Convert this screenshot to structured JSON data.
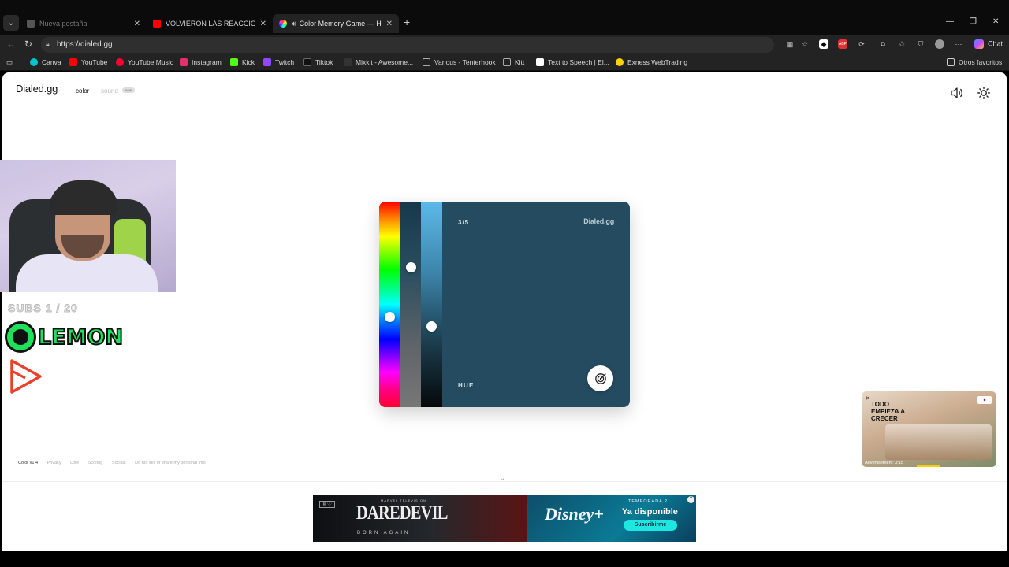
{
  "browser": {
    "tabs": [
      {
        "title": "Nueva pestaña",
        "state": "inactive",
        "favicon_color": "#555555"
      },
      {
        "title": "VOLVIERON LAS REACCIONES • D",
        "state": "inactive",
        "favicon_color": "#ff0000"
      },
      {
        "title": "Color Memory Game — How",
        "state": "active",
        "favicon_color": "#9b59b6"
      }
    ],
    "url": "https://dialed.gg",
    "chat_label": "Chat",
    "bookmarks": [
      {
        "label": "Canva",
        "color": "#00c4cc"
      },
      {
        "label": "YouTube",
        "color": "#ff0000"
      },
      {
        "label": "YouTube Music",
        "color": "#ff0033"
      },
      {
        "label": "Instagram",
        "color": "#e1306c"
      },
      {
        "label": "Kick",
        "color": "#53fc18"
      },
      {
        "label": "Twitch",
        "color": "#9146ff"
      },
      {
        "label": "Tiktok",
        "color": "#111111"
      },
      {
        "label": "Mixkit - Awesome...",
        "color": "#333333"
      },
      {
        "label": "Various - Tenterhook",
        "color": "#222222"
      },
      {
        "label": "Kitt",
        "color": "#222222"
      },
      {
        "label": "Text to Speech | El...",
        "color": "#ffffff"
      },
      {
        "label": "Exness WebTrading",
        "color": "#ffd200"
      }
    ],
    "other_favorites": "Otros favoritos"
  },
  "site": {
    "logo": "Dialed.gg",
    "nav": {
      "color": "color",
      "sound": "sound",
      "new_badge": "new"
    },
    "icons": {
      "volume": "volume-icon",
      "theme": "sun-icon"
    }
  },
  "game": {
    "progress": "3/5",
    "brand": "Dialed.gg",
    "mode_label": "HUE",
    "target_color": "#254b60",
    "sliders": {
      "hue": 0.56,
      "saturation": 0.32,
      "brightness": 0.61
    },
    "submit_icon": "target-icon"
  },
  "footer": {
    "links": [
      "Color v1.4",
      "Privacy",
      "Lore",
      "Scoring",
      "Socials",
      "Do not sell or share my personal info"
    ]
  },
  "banner_ad": {
    "left_network": "MARVEL TELEVISION",
    "left_title": "DAREDEVIL",
    "left_subtitle": "BORN AGAIN",
    "right_logo": "Disney+",
    "right_top": "TEMPORADA 2",
    "right_main": "Ya disponible",
    "right_button": "Suscribirme"
  },
  "overlay": {
    "subs": "SUBS 1 / 20",
    "lemon": "LEMON"
  },
  "side_ad": {
    "headline": "TODO EMPIEZA A CRECER",
    "meta": "Advertisement: 0:15"
  }
}
